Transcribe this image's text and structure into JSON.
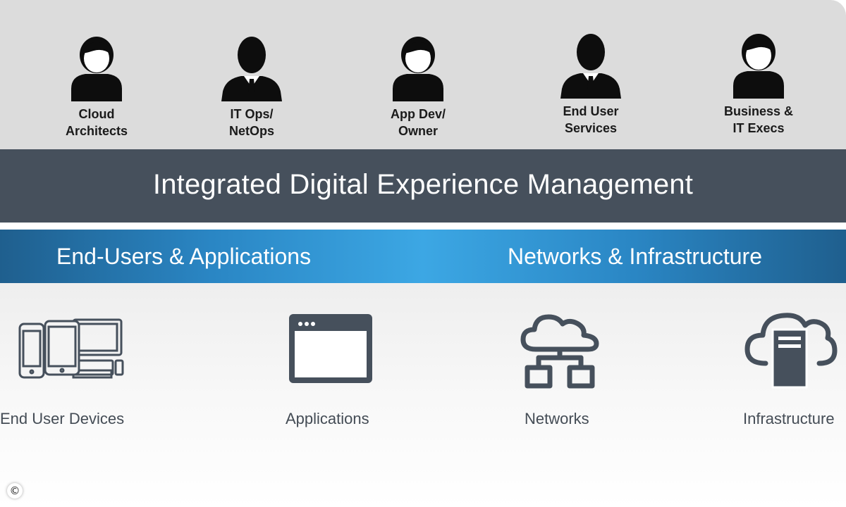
{
  "personas": [
    {
      "icon": "female-user-icon",
      "line1": "Cloud",
      "line2": "Architects"
    },
    {
      "icon": "businessman-icon",
      "line1": "IT Ops/",
      "line2": "NetOps"
    },
    {
      "icon": "female-user-icon",
      "line1": "App Dev/",
      "line2": "Owner"
    },
    {
      "icon": "businessman-icon",
      "line1": "End User",
      "line2": "Services"
    },
    {
      "icon": "female-user-icon",
      "line1": "Business &",
      "line2": "IT Execs"
    }
  ],
  "banner": {
    "title": "Integrated Digital Experience Management"
  },
  "domains": {
    "left": "End-Users & Applications",
    "right": "Networks & Infrastructure"
  },
  "resources": [
    {
      "icon": "devices-icon",
      "label": "End User Devices"
    },
    {
      "icon": "browser-window-icon",
      "label": "Applications"
    },
    {
      "icon": "cloud-network-icon",
      "label": "Networks"
    },
    {
      "icon": "cloud-server-icon",
      "label": "Infrastructure"
    }
  ],
  "copyright": "©",
  "colors": {
    "persona_band": "#dcdcdc",
    "banner": "#46505c",
    "blue_light": "#3ca7e4",
    "blue_dark": "#1f5f8e",
    "icon_slate": "#46505c"
  }
}
